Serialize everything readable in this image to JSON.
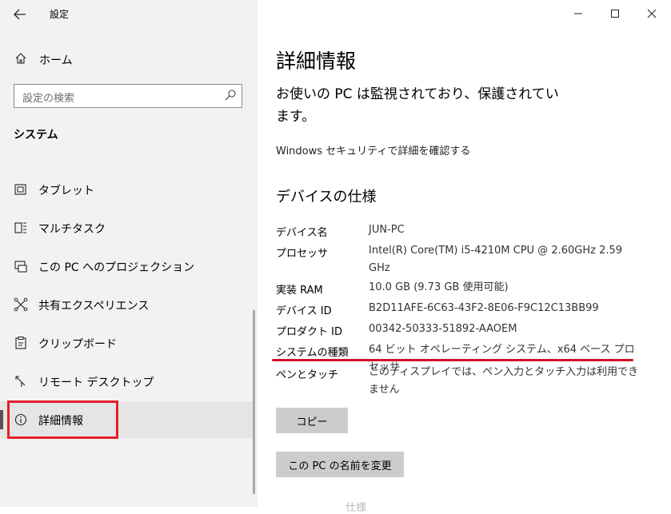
{
  "app": {
    "title": "設定"
  },
  "sidebar": {
    "home_label": "ホーム",
    "search_placeholder": "設定の検索",
    "section_title": "システム",
    "items": [
      {
        "label": "タブレット",
        "icon": "tablet-icon"
      },
      {
        "label": "マルチタスク",
        "icon": "multitask-icon"
      },
      {
        "label": "この PC へのプロジェクション",
        "icon": "projection-icon"
      },
      {
        "label": "共有エクスペリエンス",
        "icon": "shared-experience-icon"
      },
      {
        "label": "クリップボード",
        "icon": "clipboard-icon"
      },
      {
        "label": "リモート デスクトップ",
        "icon": "remote-desktop-icon"
      },
      {
        "label": "詳細情報",
        "icon": "info-icon",
        "selected": true
      }
    ]
  },
  "main": {
    "title": "詳細情報",
    "protect_message": "お使いの PC は監視されており、保護されています。",
    "security_link": "Windows セキュリティで詳細を確認する",
    "spec_title": "デバイスの仕様",
    "specs": [
      {
        "label": "デバイス名",
        "value": "JUN-PC"
      },
      {
        "label": "プロセッサ",
        "value": "Intel(R) Core(TM) i5-4210M CPU @ 2.60GHz   2.59 GHz"
      },
      {
        "label": "実装 RAM",
        "value": "10.0 GB (9.73 GB 使用可能)"
      },
      {
        "label": "デバイス ID",
        "value": "B2D11AFE-6C63-43F2-8E06-F9C12C13BB99"
      },
      {
        "label": "プロダクト ID",
        "value": "00342-50333-51892-AAOEM"
      },
      {
        "label": "システムの種類",
        "value": "64 ビット オペレーティング システム、x64 ベース プロセッサ"
      },
      {
        "label": "ペンとタッチ",
        "value": "このディスプレイでは、ペン入力とタッチ入力は利用できません"
      }
    ],
    "copy_button": "コピー",
    "rename_button": "この PC の名前を変更",
    "faded_text": "仕様"
  },
  "colors": {
    "highlight": "#e4202a",
    "sidebar_bg": "#f2f2f2",
    "button_bg": "#cccccc"
  }
}
